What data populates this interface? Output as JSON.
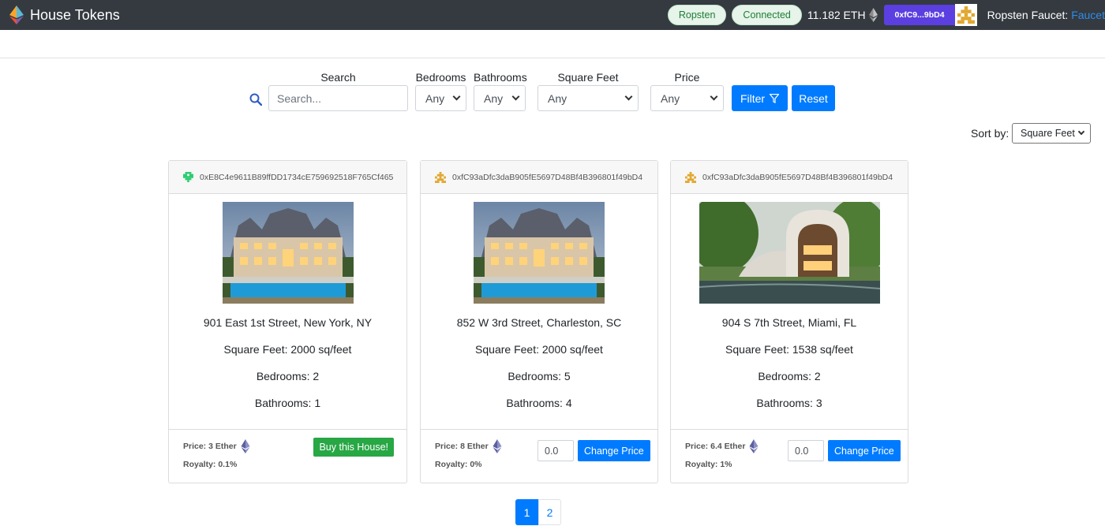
{
  "app": {
    "title": "House Tokens"
  },
  "nav": {
    "network": "Ropsten",
    "status": "Connected",
    "balance": "11.182 ETH",
    "account": "0xfC9...9bD4",
    "faucet_label": "Ropsten Faucet:",
    "faucet_link": "Faucet"
  },
  "filters": {
    "search_label": "Search",
    "search_placeholder": "Search...",
    "bedrooms_label": "Bedrooms",
    "bedrooms_value": "Any",
    "bathrooms_label": "Bathrooms",
    "bathrooms_value": "Any",
    "sqft_label": "Square Feet",
    "sqft_value": "Any",
    "price_label": "Price",
    "price_value": "Any",
    "filter_button": "Filter",
    "reset_button": "Reset"
  },
  "sort": {
    "label": "Sort by:",
    "value": "Square Feet"
  },
  "listings": [
    {
      "owner": "0xE8C4e9611B89ffDD1734cE759692518F765Cf465",
      "address": "901 East 1st Street, New York, NY",
      "sqft": "Square Feet: 2000 sq/feet",
      "bedrooms": "Bedrooms: 2",
      "bathrooms": "Bathrooms: 1",
      "price": "Price: 3 Ether",
      "royalty": "Royalty: 0.1%",
      "action": "Buy this House!"
    },
    {
      "owner": "0xfC93aDfc3daB905fE5697D48Bf4B396801f49bD4",
      "address": "852 W 3rd Street, Charleston, SC",
      "sqft": "Square Feet: 2000 sq/feet",
      "bedrooms": "Bedrooms: 5",
      "bathrooms": "Bathrooms: 4",
      "price": "Price: 8 Ether",
      "royalty": "Royalty: 0%",
      "price_input": "0.0",
      "action": "Change Price"
    },
    {
      "owner": "0xfC93aDfc3daB905fE5697D48Bf4B396801f49bD4",
      "address": "904 S 7th Street, Miami, FL",
      "sqft": "Square Feet: 1538 sq/feet",
      "bedrooms": "Bedrooms: 2",
      "bathrooms": "Bathrooms: 3",
      "price": "Price: 6.4 Ether",
      "royalty": "Royalty: 1%",
      "price_input": "0.0",
      "action": "Change Price"
    }
  ],
  "pagination": {
    "pages": [
      "1",
      "2"
    ],
    "current": "1"
  },
  "icons": {
    "logo": "ethereum-logo-icon",
    "eth": "ethereum-icon",
    "search": "search-icon",
    "filter": "funnel-icon",
    "identicon": "identicon-icon"
  },
  "colors": {
    "navbar": "#343a40",
    "primary": "#007bff",
    "success": "#28a745",
    "account": "#5b3fe0"
  }
}
